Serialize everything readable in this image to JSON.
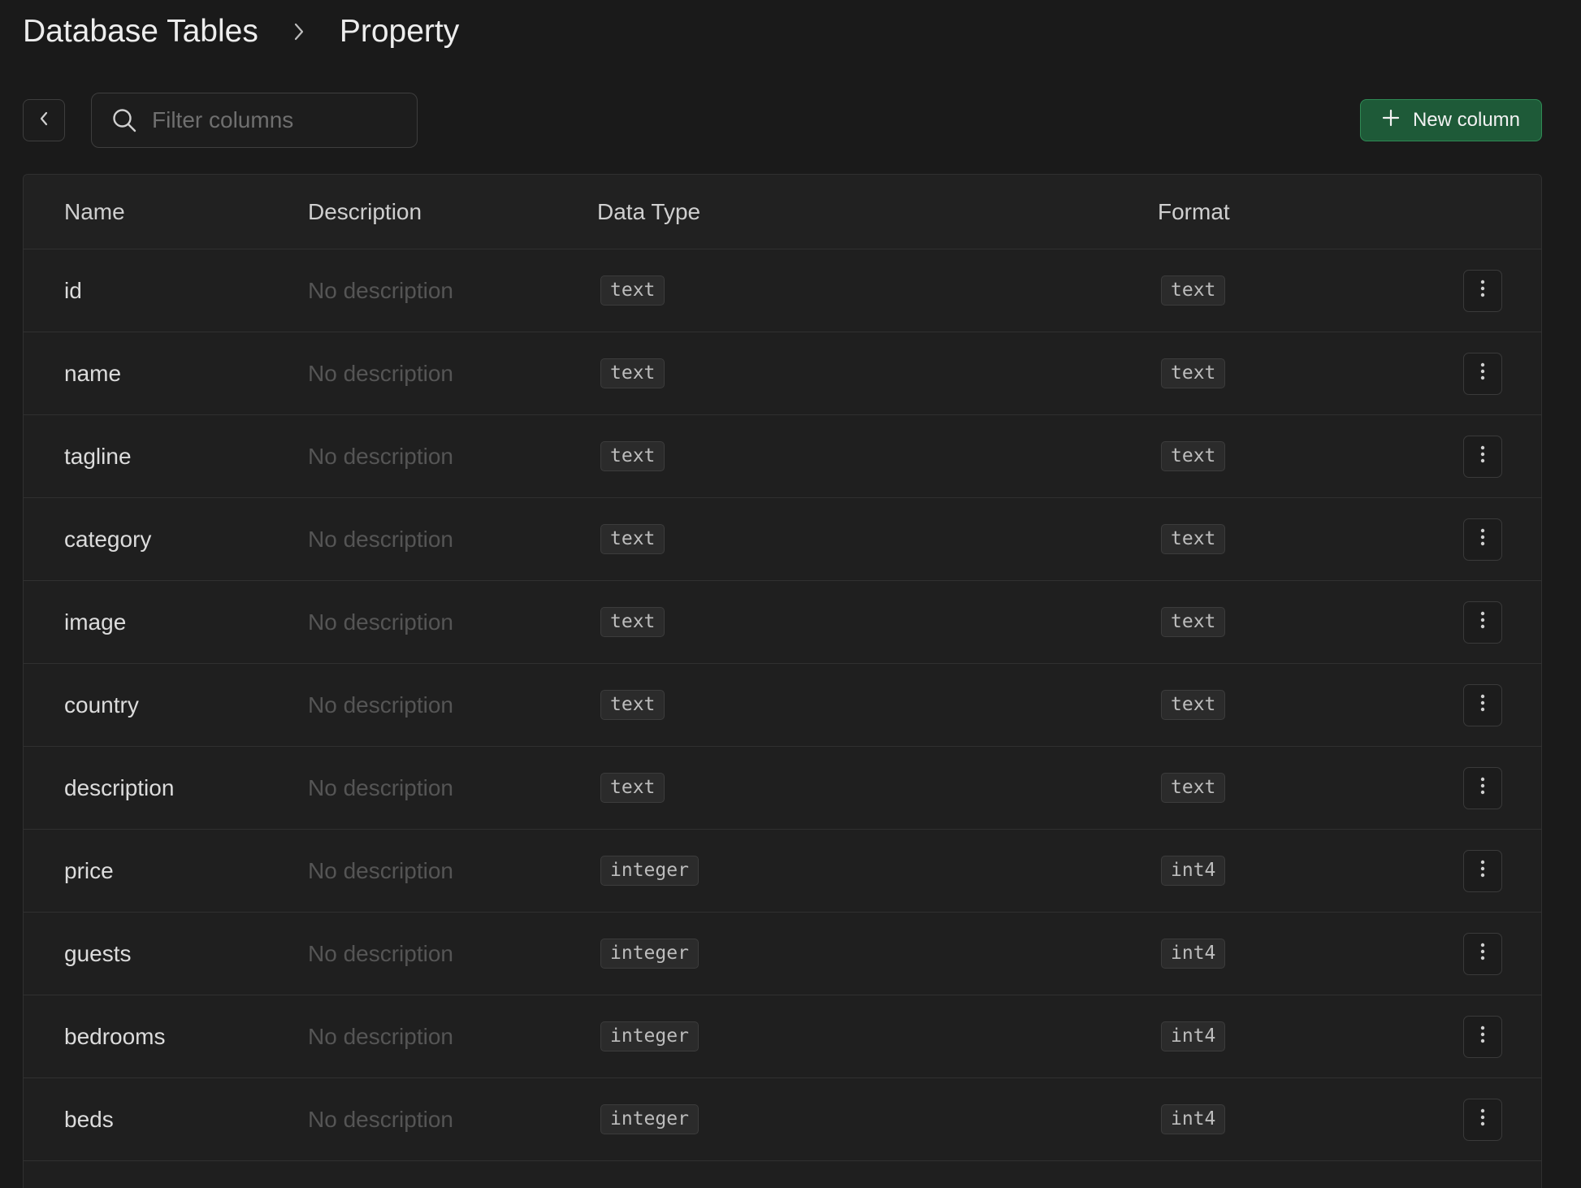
{
  "breadcrumb": {
    "root": "Database Tables",
    "current": "Property"
  },
  "toolbar": {
    "search_placeholder": "Filter columns",
    "new_column_label": "New column"
  },
  "table": {
    "headers": [
      "Name",
      "Description",
      "Data Type",
      "Format"
    ],
    "rows": [
      {
        "name": "id",
        "description": "No description",
        "data_type": "text",
        "format": "text"
      },
      {
        "name": "name",
        "description": "No description",
        "data_type": "text",
        "format": "text"
      },
      {
        "name": "tagline",
        "description": "No description",
        "data_type": "text",
        "format": "text"
      },
      {
        "name": "category",
        "description": "No description",
        "data_type": "text",
        "format": "text"
      },
      {
        "name": "image",
        "description": "No description",
        "data_type": "text",
        "format": "text"
      },
      {
        "name": "country",
        "description": "No description",
        "data_type": "text",
        "format": "text"
      },
      {
        "name": "description",
        "description": "No description",
        "data_type": "text",
        "format": "text"
      },
      {
        "name": "price",
        "description": "No description",
        "data_type": "integer",
        "format": "int4"
      },
      {
        "name": "guests",
        "description": "No description",
        "data_type": "integer",
        "format": "int4"
      },
      {
        "name": "bedrooms",
        "description": "No description",
        "data_type": "integer",
        "format": "int4"
      },
      {
        "name": "beds",
        "description": "No description",
        "data_type": "integer",
        "format": "int4"
      }
    ]
  },
  "colors": {
    "background": "#1a1a1a",
    "accent_green": "#1e5a38",
    "accent_green_border": "#2f8a55",
    "border": "#303030",
    "muted_text": "#555555"
  },
  "icons": {
    "breadcrumb_separator": "chevron-right-icon",
    "back": "chevron-left-icon",
    "search": "search-icon",
    "new_column": "plus-icon",
    "row_actions": "more-vertical-icon"
  }
}
